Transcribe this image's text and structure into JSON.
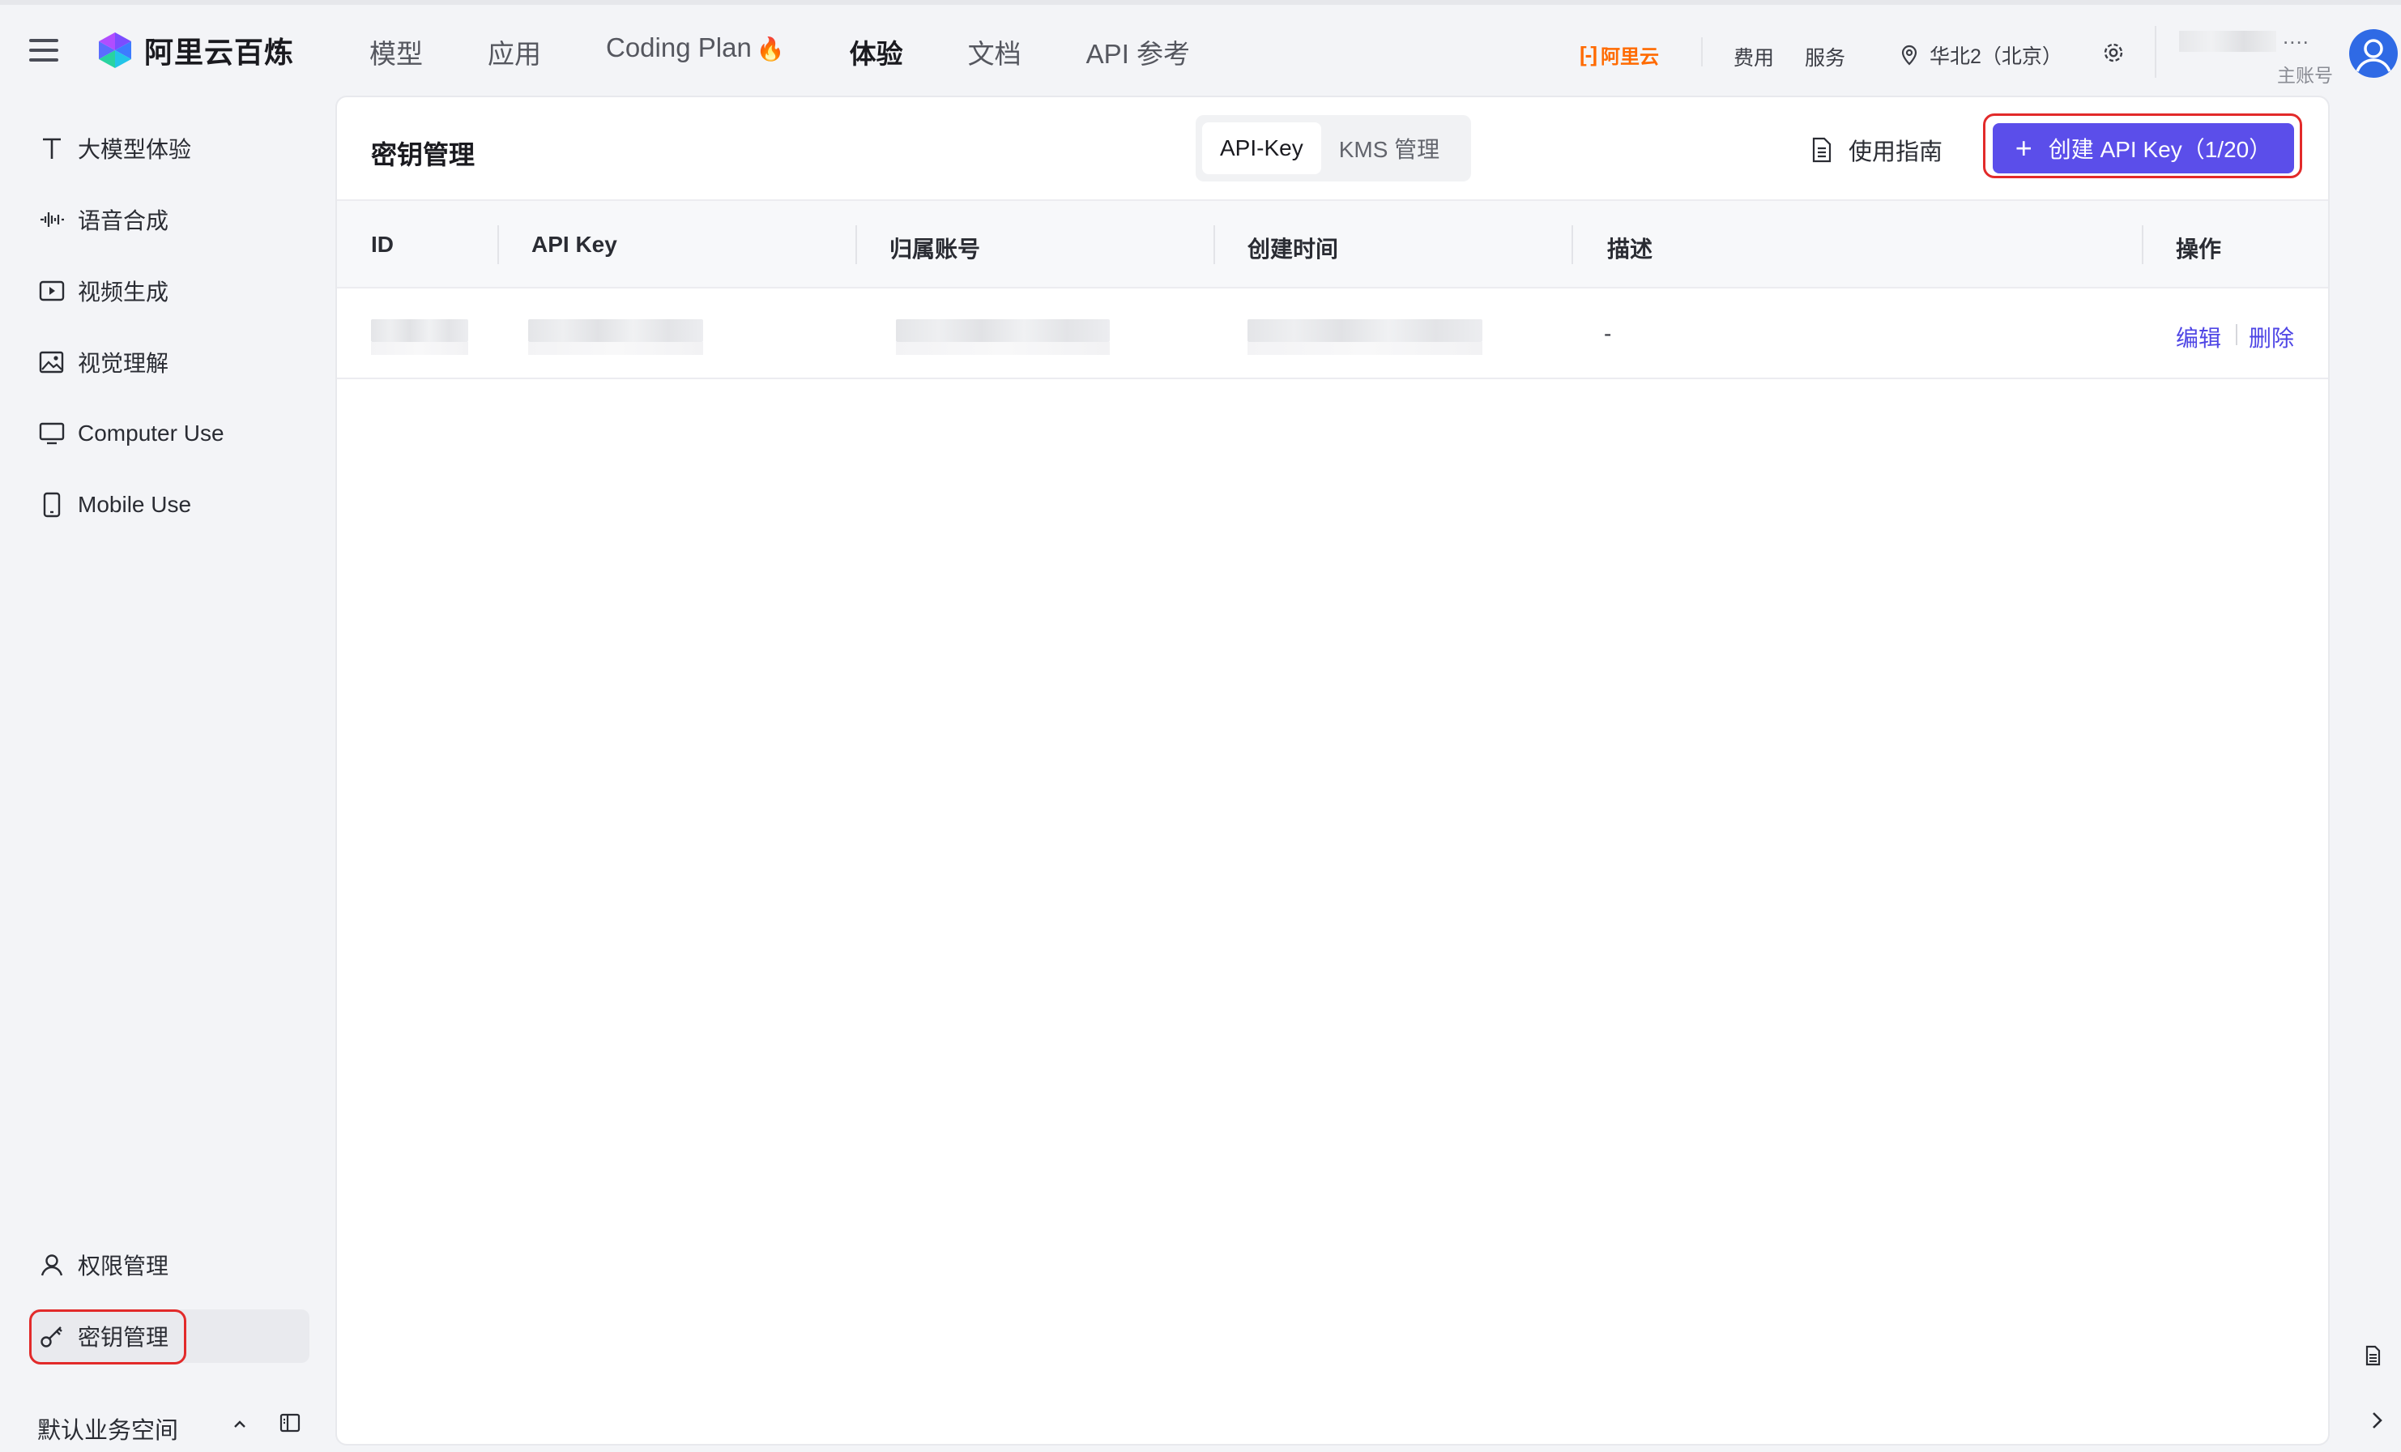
{
  "header": {
    "logo_text": "阿里云百炼",
    "nav": [
      {
        "label": "模型"
      },
      {
        "label": "应用"
      },
      {
        "label": "Coding Plan"
      },
      {
        "label": "体验"
      },
      {
        "label": "文档"
      },
      {
        "label": "API 参考"
      }
    ],
    "active_nav": "体验",
    "coding_plan_badge_icon": "flame-icon",
    "aliyun_brand": "阿里云",
    "links": {
      "fees": "费用",
      "service": "服务"
    },
    "region": "华北2（北京）",
    "account_name_suffix": "....",
    "account_type": "主账号",
    "brand_color": "#ff6a00"
  },
  "sidebar": {
    "items": [
      {
        "label": "大模型体验",
        "icon": "text-t-icon"
      },
      {
        "label": "语音合成",
        "icon": "waveform-icon"
      },
      {
        "label": "视频生成",
        "icon": "video-play-icon"
      },
      {
        "label": "视觉理解",
        "icon": "image-icon"
      },
      {
        "label": "Computer Use",
        "icon": "monitor-icon"
      },
      {
        "label": "Mobile Use",
        "icon": "mobile-icon"
      }
    ],
    "bottom_items": [
      {
        "label": "权限管理",
        "icon": "user-icon"
      },
      {
        "label": "密钥管理",
        "icon": "key-icon"
      }
    ],
    "active_item": "密钥管理",
    "workspace": "默认业务空间"
  },
  "main": {
    "title": "密钥管理",
    "tabs": [
      {
        "label": "API-Key"
      },
      {
        "label": "KMS 管理"
      }
    ],
    "active_tab": "API-Key",
    "guide_label": "使用指南",
    "create_button": "创建 API Key（1/20）",
    "accent_color": "#5b4eea",
    "table": {
      "columns": [
        "ID",
        "API Key",
        "归属账号",
        "创建时间",
        "描述",
        "操作"
      ],
      "rows": [
        {
          "id": "",
          "api_key": "",
          "account": "",
          "created": "",
          "description": "-",
          "actions": [
            "编辑",
            "删除"
          ]
        }
      ]
    }
  }
}
